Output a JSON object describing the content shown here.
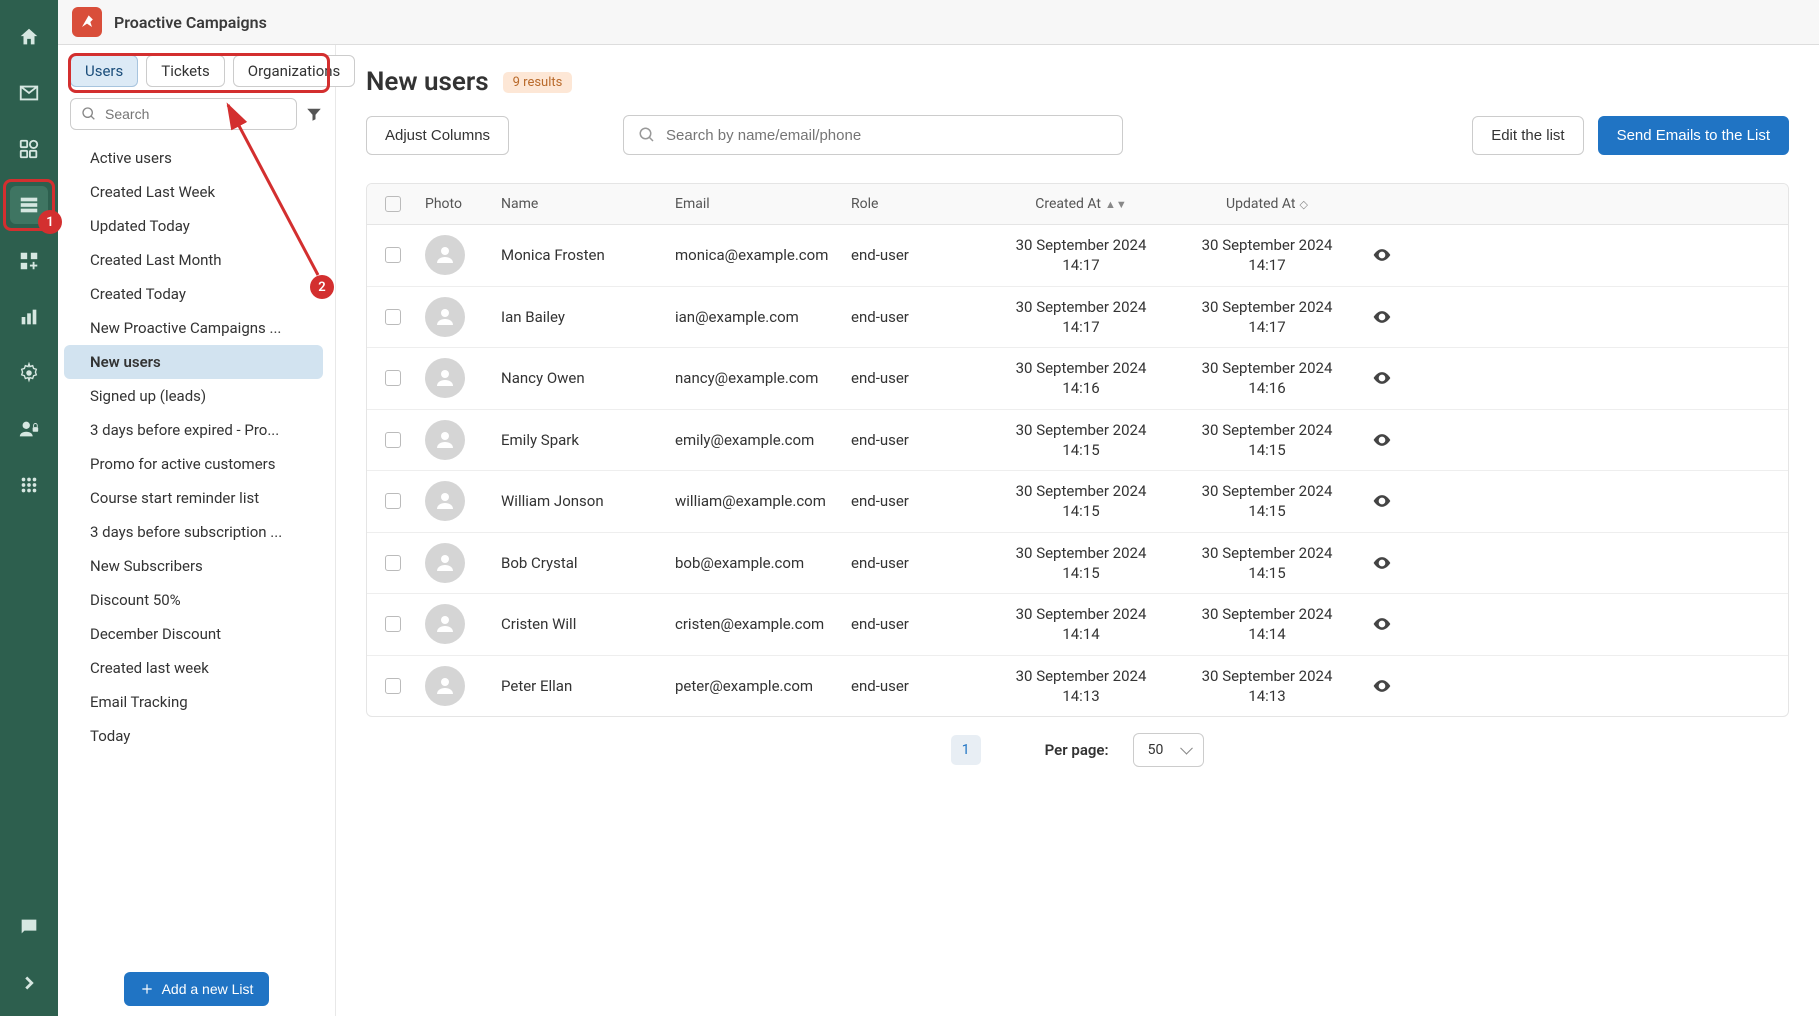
{
  "header": {
    "title": "Proactive Campaigns"
  },
  "annotations": {
    "badge1": "1",
    "badge2": "2"
  },
  "sidebar": {
    "tabs": [
      {
        "label": "Users",
        "active": true
      },
      {
        "label": "Tickets",
        "active": false
      },
      {
        "label": "Organizations",
        "active": false
      }
    ],
    "search_placeholder": "Search",
    "lists": [
      "Active users",
      "Created Last Week",
      "Updated Today",
      "Created Last Month",
      "Created Today",
      "New Proactive Campaigns ...",
      "New users",
      "Signed up (leads)",
      "3 days before expired - Pro...",
      "Promo for active customers",
      "Course start reminder list",
      "3 days before subscription ...",
      "New Subscribers",
      "Discount 50%",
      "December Discount",
      "Created last week",
      "Email Tracking",
      "Today"
    ],
    "selected_index": 6,
    "add_button": "Add a new List"
  },
  "main": {
    "title": "New users",
    "results_label": "9 results",
    "adjust_columns": "Adjust Columns",
    "search_placeholder": "Search by name/email/phone",
    "edit_list": "Edit the list",
    "send_emails": "Send Emails to the List",
    "columns": {
      "photo": "Photo",
      "name": "Name",
      "email": "Email",
      "role": "Role",
      "created": "Created At",
      "updated": "Updated At"
    },
    "rows": [
      {
        "name": "Monica Frosten",
        "email": "monica@example.com",
        "role": "end-user",
        "created": "30 September 2024 14:17",
        "updated": "30 September 2024 14:17"
      },
      {
        "name": "Ian Bailey",
        "email": "ian@example.com",
        "role": "end-user",
        "created": "30 September 2024 14:17",
        "updated": "30 September 2024 14:17"
      },
      {
        "name": "Nancy Owen",
        "email": "nancy@example.com",
        "role": "end-user",
        "created": "30 September 2024 14:16",
        "updated": "30 September 2024 14:16"
      },
      {
        "name": "Emily Spark",
        "email": "emily@example.com",
        "role": "end-user",
        "created": "30 September 2024 14:15",
        "updated": "30 September 2024 14:15"
      },
      {
        "name": "William Jonson",
        "email": "william@example.com",
        "role": "end-user",
        "created": "30 September 2024 14:15",
        "updated": "30 September 2024 14:15"
      },
      {
        "name": "Bob Crystal",
        "email": "bob@example.com",
        "role": "end-user",
        "created": "30 September 2024 14:15",
        "updated": "30 September 2024 14:15"
      },
      {
        "name": "Cristen Will",
        "email": "cristen@example.com",
        "role": "end-user",
        "created": "30 September 2024 14:14",
        "updated": "30 September 2024 14:14"
      },
      {
        "name": "Peter Ellan",
        "email": "peter@example.com",
        "role": "end-user",
        "created": "30 September 2024 14:13",
        "updated": "30 September 2024 14:13"
      }
    ],
    "page": "1",
    "per_page_label": "Per page:",
    "per_page_value": "50"
  }
}
